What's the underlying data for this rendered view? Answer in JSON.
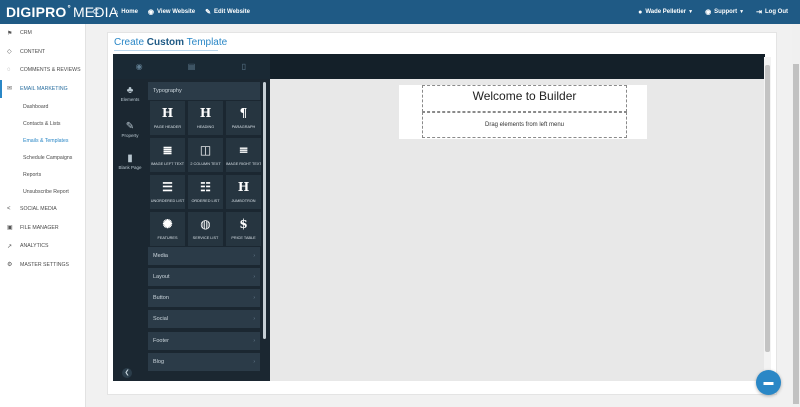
{
  "brand": {
    "name": "DIGIPRO",
    "suffix": "MEDIA",
    "mark": "°"
  },
  "topnav": {
    "collapse_icon": "«",
    "items": [
      {
        "icon": "⌂",
        "label": "Home"
      },
      {
        "icon": "◉",
        "label": "View Website"
      },
      {
        "icon": "✎",
        "label": "Edit Website"
      }
    ],
    "user": {
      "icon": "●",
      "label": "Wade Pelletier"
    },
    "support": {
      "icon": "◉",
      "label": "Support"
    },
    "logout": {
      "icon": "⇥",
      "label": "Log Out"
    }
  },
  "sidebar": {
    "items": [
      {
        "icon": "⚑",
        "label": "CRM"
      },
      {
        "icon": "◇",
        "label": "CONTENT"
      },
      {
        "icon": "◌",
        "label": "COMMENTS & REVIEWS"
      },
      {
        "icon": "✉",
        "label": "EMAIL MARKETING"
      }
    ],
    "subitems": [
      {
        "label": "Dashboard"
      },
      {
        "label": "Contacts & Lists"
      },
      {
        "label": "Emails & Templates"
      },
      {
        "label": "Schedule Campaigns"
      },
      {
        "label": "Reports"
      },
      {
        "label": "Unsubscribe Report"
      }
    ],
    "items2": [
      {
        "icon": "<",
        "label": "SOCIAL MEDIA"
      },
      {
        "icon": "▣",
        "label": "FILE MANAGER"
      },
      {
        "icon": "↗",
        "label": "ANALYTICS"
      },
      {
        "icon": "⚙",
        "label": "MASTER SETTINGS"
      }
    ]
  },
  "page": {
    "title_pre": "Create ",
    "title_bold": "Custom",
    "title_post": " Template"
  },
  "builder": {
    "toolbar": {
      "preview": "◉",
      "save": "▤",
      "mobile": "▯"
    },
    "rail": [
      {
        "icon": "♣",
        "label": "Elements"
      },
      {
        "icon": "✎",
        "label": "Property"
      },
      {
        "icon": "▮",
        "label": "Blank Page"
      }
    ],
    "rail_toggle": "❮",
    "sections": [
      "Typography",
      "Media",
      "Layout",
      "Button",
      "Social",
      "Footer",
      "Blog"
    ],
    "chevron": "›",
    "tiles": [
      {
        "icon": "H",
        "label": "PAGE HEADER"
      },
      {
        "icon": "H",
        "label": "HEADING"
      },
      {
        "icon": "¶",
        "label": "PARAGRAPH"
      },
      {
        "icon": "≣",
        "label": "IMAGE LEFT TEXT"
      },
      {
        "icon": "◫",
        "label": "2 COLUMN TEXT"
      },
      {
        "icon": "≡",
        "label": "IMAGE RIGHT TEXT"
      },
      {
        "icon": "☰",
        "label": "UNORDERED LIST"
      },
      {
        "icon": "☷",
        "label": "ORDERED LIST"
      },
      {
        "icon": "H",
        "label": "JUMBOTRON"
      },
      {
        "icon": "✺",
        "label": "FEATURES"
      },
      {
        "icon": "◍",
        "label": "SERVICE LIST"
      },
      {
        "icon": "$",
        "label": "PRICE TABLE"
      }
    ],
    "canvas": {
      "heading": "Welcome to Builder",
      "hint": "Drag elements from left menu"
    }
  },
  "chat": {
    "icon": "▬"
  }
}
